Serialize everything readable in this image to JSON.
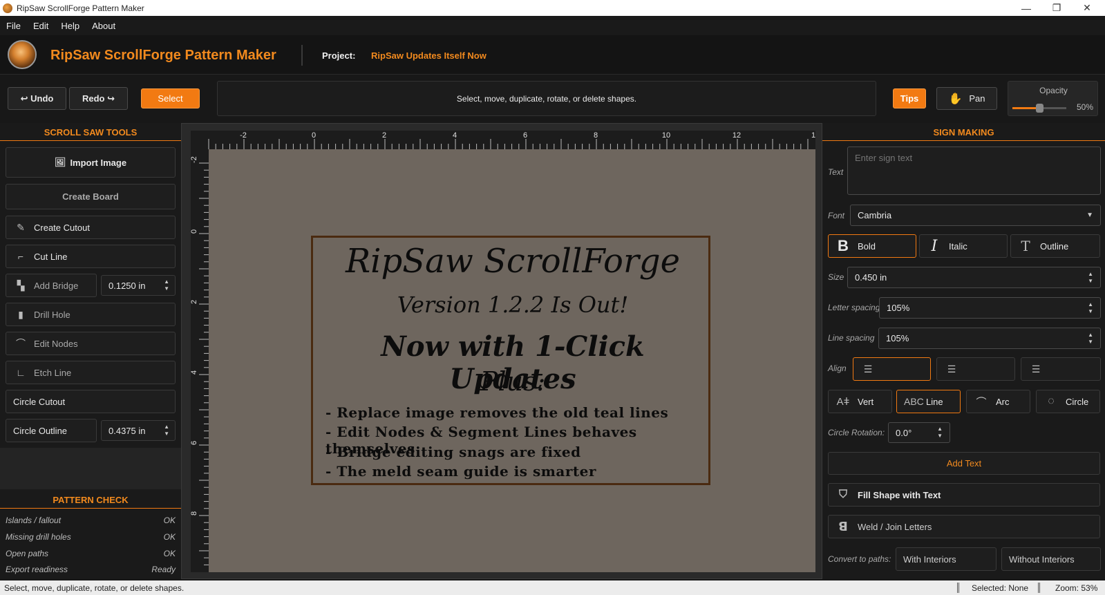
{
  "window": {
    "title": "RipSaw ScrollForge Pattern Maker",
    "minimize": "—",
    "restore": "❐",
    "close": "✕"
  },
  "menu": [
    "File",
    "Edit",
    "Help",
    "About"
  ],
  "header": {
    "app_name": "RipSaw ScrollForge Pattern Maker",
    "project_label": "Project:",
    "project_name": "RipSaw Updates Itself Now"
  },
  "toolbar": {
    "undo": "↩ Undo",
    "redo": "Redo ↪",
    "select": "Select",
    "hint": "Select, move, duplicate, rotate, or delete shapes.",
    "tips": "Tips",
    "pan": "Pan",
    "opacity_label": "Opacity",
    "opacity_value": "50%",
    "opacity_fraction": 0.5
  },
  "left_panel": {
    "title": "SCROLL SAW TOOLS",
    "tools": [
      {
        "label": "Import Image",
        "icon": "image-icon"
      },
      {
        "label": "Create Board"
      },
      {
        "label": "Create Cutout",
        "icon": "pencil-icon"
      },
      {
        "label": "Cut Line",
        "icon": "cut-line-icon"
      },
      {
        "label": "Add Bridge",
        "icon": "bridge-icon",
        "value": "0.1250 in"
      },
      {
        "label": "Drill Hole",
        "icon": "drill-icon"
      },
      {
        "label": "Edit Nodes",
        "icon": "nodes-icon"
      },
      {
        "label": "Etch Line",
        "icon": "etch-icon"
      },
      {
        "label": "Circle Cutout"
      },
      {
        "label": "Circle Outline",
        "value": "0.4375 in"
      }
    ],
    "check_title": "PATTERN CHECK",
    "checks": [
      {
        "name": "Islands / fallout",
        "status": "OK"
      },
      {
        "name": "Missing drill holes",
        "status": "OK"
      },
      {
        "name": "Open paths",
        "status": "OK"
      },
      {
        "name": "Export readiness",
        "status": "Ready"
      }
    ]
  },
  "canvas": {
    "ruler_top": [
      "-2",
      "0",
      "2",
      "4",
      "6",
      "8",
      "10",
      "12",
      "1"
    ],
    "ruler_left": [
      "-2",
      "0",
      "2",
      "4",
      "6",
      "8"
    ],
    "sign": {
      "line1": "RipSaw ScrollForge",
      "line2": "Version 1.2.2 Is Out!",
      "line3": "Now with 1-Click Updates",
      "line4": "Plus:",
      "bullets": [
        "- Replace image removes the old teal lines",
        "- Edit Nodes & Segment Lines behaves themselves",
        "- Bridge editing snags are fixed",
        "- The meld seam guide is smarter"
      ]
    }
  },
  "right_panel": {
    "title": "SIGN MAKING",
    "text_label": "Text",
    "text_placeholder": "Enter sign text",
    "font_label": "Font",
    "font_value": "Cambria",
    "style_bold": "Bold",
    "style_italic": "Italic",
    "style_outline": "Outline",
    "size_label": "Size",
    "size_value": "0.450 in",
    "letter_label": "Letter spacing",
    "letter_value": "105%",
    "line_label": "Line spacing",
    "line_value": "105%",
    "align_label": "Align",
    "mode_vert": "Vert",
    "mode_line": "Line",
    "mode_arc": "Arc",
    "mode_circle": "Circle",
    "rotation_label": "Circle Rotation:",
    "rotation_value": "0.0°",
    "add_text": "Add Text",
    "fill_shape": "Fill Shape with Text",
    "weld": "Weld / Join Letters",
    "convert_label": "Convert to paths:",
    "with_interiors": "With Interiors",
    "without_interiors": "Without Interiors"
  },
  "statusbar": {
    "hint": "Select, move, duplicate, rotate, or delete shapes.",
    "selected": "Selected: None",
    "zoom": "Zoom: 53%"
  },
  "colors": {
    "accent": "#f27a12",
    "background": "#181818",
    "board": "#6e665e",
    "sign_border": "#4a2a10"
  }
}
